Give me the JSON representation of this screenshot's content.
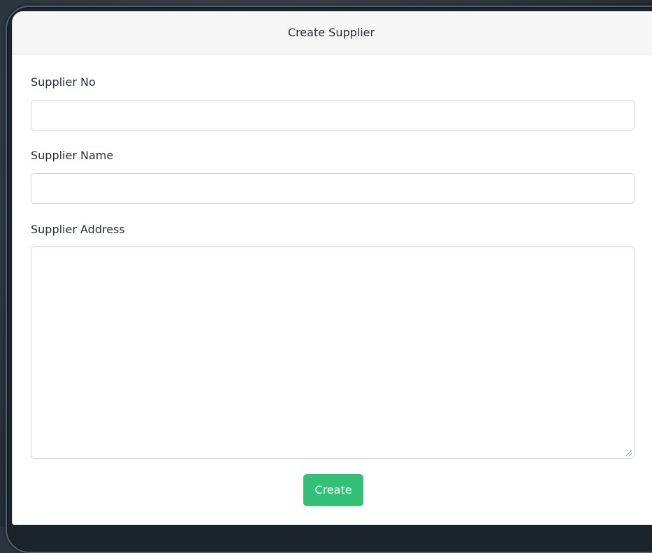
{
  "form": {
    "title": "Create Supplier",
    "fields": [
      {
        "label": "Supplier No",
        "value": "",
        "placeholder": ""
      },
      {
        "label": "Supplier Name",
        "value": "",
        "placeholder": ""
      },
      {
        "label": "Supplier Address",
        "value": "",
        "placeholder": ""
      }
    ],
    "submit_label": "Create"
  },
  "colors": {
    "accent": "#33c17a",
    "header_bg": "#f7f7f7",
    "border": "#ced4da"
  }
}
